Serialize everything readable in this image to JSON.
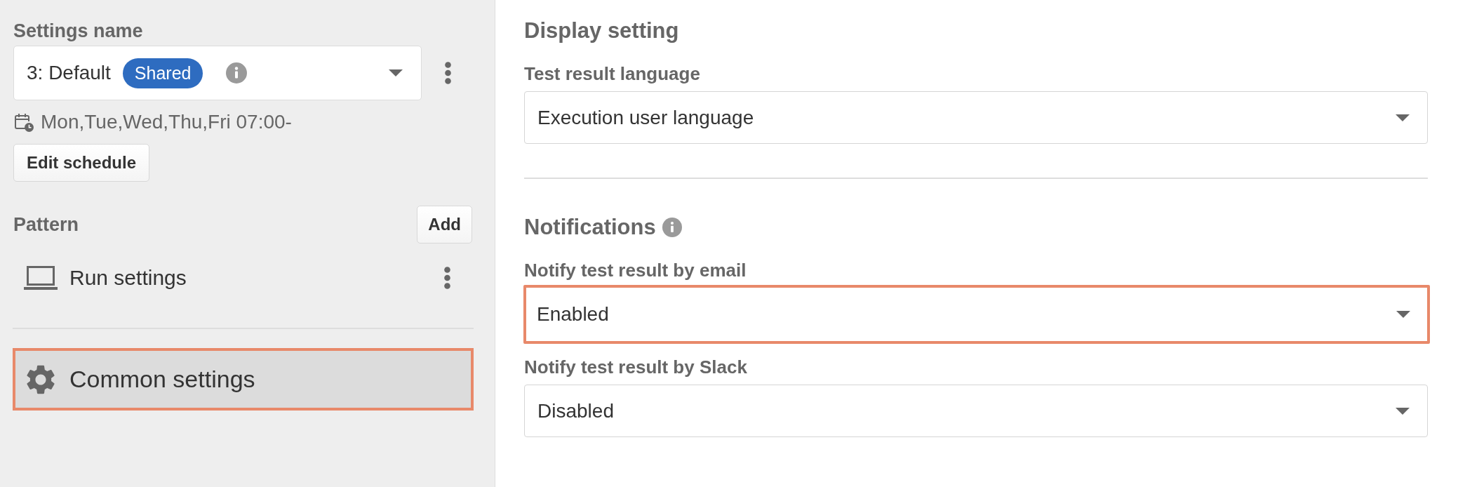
{
  "sidebar": {
    "settings_name": {
      "label": "Settings name",
      "value": "3: Default",
      "badge": "Shared",
      "info": true
    },
    "schedule": {
      "text": "Mon,Tue,Wed,Thu,Fri 07:00-",
      "button": "Edit schedule"
    },
    "pattern": {
      "label": "Pattern",
      "add_button": "Add",
      "items": [
        {
          "label": "Run settings",
          "selected": false,
          "highlighted": false
        }
      ]
    },
    "common_settings": {
      "label": "Common settings",
      "selected": true,
      "highlighted": true
    }
  },
  "main": {
    "sections": [
      {
        "title": "Display setting",
        "info": false,
        "fields": [
          {
            "label": "Test result language",
            "value": "Execution user language",
            "highlighted": false
          }
        ]
      },
      {
        "title": "Notifications",
        "info": true,
        "fields": [
          {
            "label": "Notify test result by email",
            "value": "Enabled",
            "highlighted": true
          },
          {
            "label": "Notify test result by Slack",
            "value": "Disabled",
            "highlighted": false
          }
        ]
      }
    ]
  }
}
